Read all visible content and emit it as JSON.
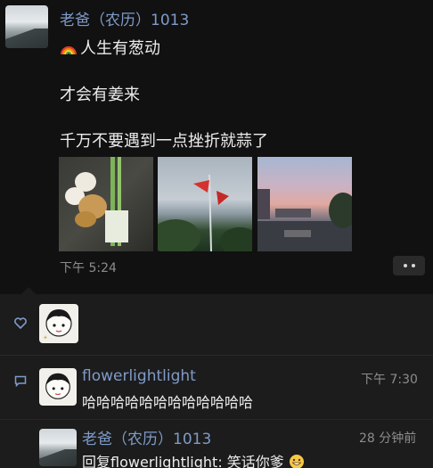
{
  "post": {
    "author": "老爸（农历）1013",
    "lines": [
      "人生有葱动",
      "才会有姜来",
      "千万不要遇到一点挫折就蒜了"
    ],
    "time": "下午 5:24",
    "photos": [
      "garlic-ginger-scallion-photo",
      "flag-pole-sky-photo",
      "sunset-river-photo"
    ]
  },
  "likes": {
    "icon": "heart-icon"
  },
  "comments": [
    {
      "author": "flowerlightlight",
      "text": "哈哈哈哈哈哈哈哈哈哈哈哈",
      "time": "下午 7:30"
    },
    {
      "author": "老爸（农历）1013",
      "reply_prefix": "回复",
      "reply_to": "flowerlightlight",
      "text": ": 笑话你爹",
      "emoji": "grin-emoji",
      "time": "28 分钟前"
    }
  ],
  "colors": {
    "background": "#111111",
    "name_blue": "#7f9bc9",
    "comment_panel": "#1c1c1c"
  }
}
